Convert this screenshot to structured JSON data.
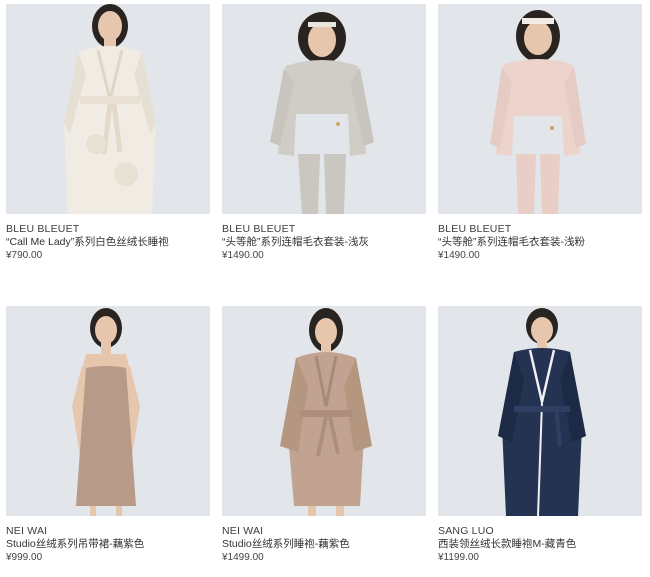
{
  "products": [
    {
      "brand": "BLEU BLEUET",
      "title": "“Call Me Lady”系列白色丝绒长睡袍",
      "price": "¥790.00",
      "image_icon": "model-white-velvet-robe"
    },
    {
      "brand": "BLEU BLEUET",
      "title": "“头等舱”系列连帽毛衣套装-浅灰",
      "price": "¥1490.00",
      "image_icon": "model-grey-hoodie-set"
    },
    {
      "brand": "BLEU BLEUET",
      "title": "“头等舱”系列连帽毛衣套装-浅粉",
      "price": "¥1490.00",
      "image_icon": "model-pink-hoodie-set"
    },
    {
      "brand": "NEI WAI",
      "title": "Studio丝绒系列吊带裙-藕紫色",
      "price": "¥999.00",
      "image_icon": "model-slip-dress"
    },
    {
      "brand": "NEI WAI",
      "title": "Studio丝绒系列睡袍-藕紫色",
      "price": "¥1499.00",
      "image_icon": "model-velvet-robe"
    },
    {
      "brand": "SANG LUO",
      "title": "西装领丝绒长款睡袍M-藏青色",
      "price": "¥1199.00",
      "image_icon": "model-navy-velvet-robe"
    }
  ],
  "colors": {
    "photo_bg": "#e2e6ea",
    "white_robe": "#f1ece3",
    "grey_set": "#cfcdc6",
    "pink_set": "#ecd3cc",
    "mauve": "#b89a88",
    "navy": "#243352",
    "hair": "#2a2421",
    "skin": "#e7c6ae"
  }
}
